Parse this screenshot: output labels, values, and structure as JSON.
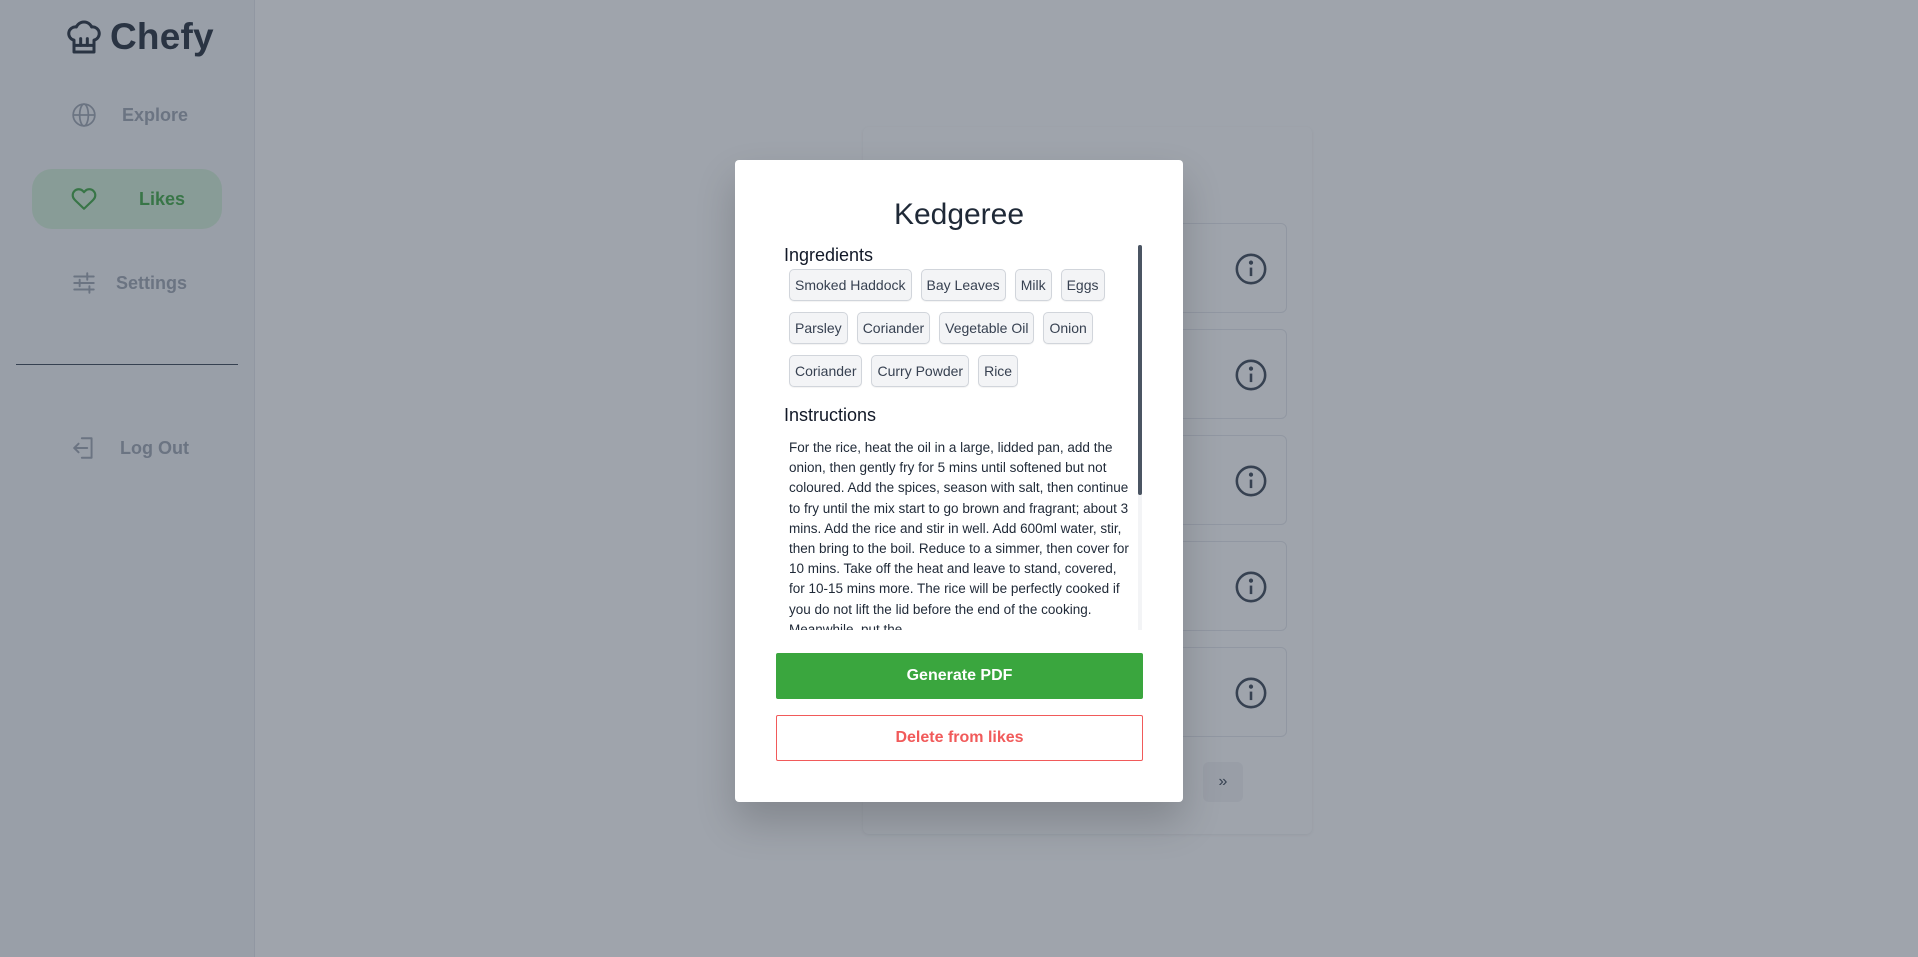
{
  "brand": {
    "name": "Chefy",
    "icon": "chef-hat-icon"
  },
  "sidebar": {
    "items": [
      {
        "label": "Explore",
        "icon": "globe-icon",
        "active": false
      },
      {
        "label": "Likes",
        "icon": "heart-icon",
        "active": true
      },
      {
        "label": "Settings",
        "icon": "sliders-icon",
        "active": false
      }
    ],
    "logout": {
      "label": "Log Out",
      "icon": "logout-icon"
    }
  },
  "background": {
    "rows": [
      {
        "icon": "info-icon"
      },
      {
        "icon": "info-icon"
      },
      {
        "icon": "info-icon"
      },
      {
        "icon": "info-icon"
      },
      {
        "icon": "info-icon"
      }
    ],
    "pager_next": "»"
  },
  "modal": {
    "title": "Kedgeree",
    "ingredients_heading": "Ingredients",
    "ingredients": [
      "Smoked Haddock",
      "Bay Leaves",
      "Milk",
      "Eggs",
      "Parsley",
      "Coriander",
      "Vegetable Oil",
      "Onion",
      "Coriander",
      "Curry Powder",
      "Rice"
    ],
    "instructions_heading": "Instructions",
    "instructions": "For the rice, heat the oil in a large, lidded pan, add the onion, then gently fry for 5 mins until softened but not coloured. Add the spices, season with salt, then continue to fry until the mix start to go brown and fragrant; about 3 mins. Add the rice and stir in well. Add 600ml water, stir, then bring to the boil. Reduce to a simmer, then cover for 10 mins. Take off the heat and leave to stand, covered, for 10-15 mins more. The rice will be perfectly cooked if you do not lift the lid before the end of the cooking. Meanwhile, put the",
    "generate_pdf_label": "Generate PDF",
    "delete_label": "Delete from likes"
  },
  "colors": {
    "accent": "#3aa63e",
    "active_bg": "#d4f0d6",
    "danger": "#f15a5a",
    "overlay": "rgba(55,65,81,0.48)"
  }
}
